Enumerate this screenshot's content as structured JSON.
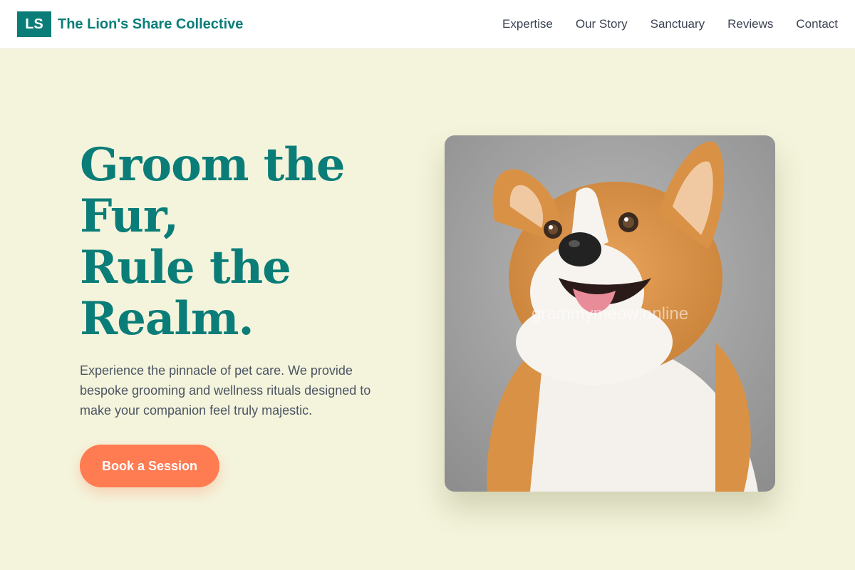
{
  "brand": {
    "logo_text": "LS",
    "name": "The Lion's Share Collective"
  },
  "nav": {
    "items": [
      "Expertise",
      "Our Story",
      "Sanctuary",
      "Reviews",
      "Contact"
    ]
  },
  "hero": {
    "title_lines": [
      "Groom the",
      "Fur,",
      "Rule the",
      "Realm."
    ],
    "description": "Experience the pinnacle of pet care. We provide bespoke grooming and wellness rituals designed to make your companion feel truly majestic.",
    "cta_label": "Book a Session"
  },
  "image": {
    "subject": "corgi-dog-photo",
    "watermark": "grammymeow.online"
  },
  "colors": {
    "accent": "#0b7d78",
    "cta": "#ff7b52",
    "background": "#f4f4dc"
  }
}
